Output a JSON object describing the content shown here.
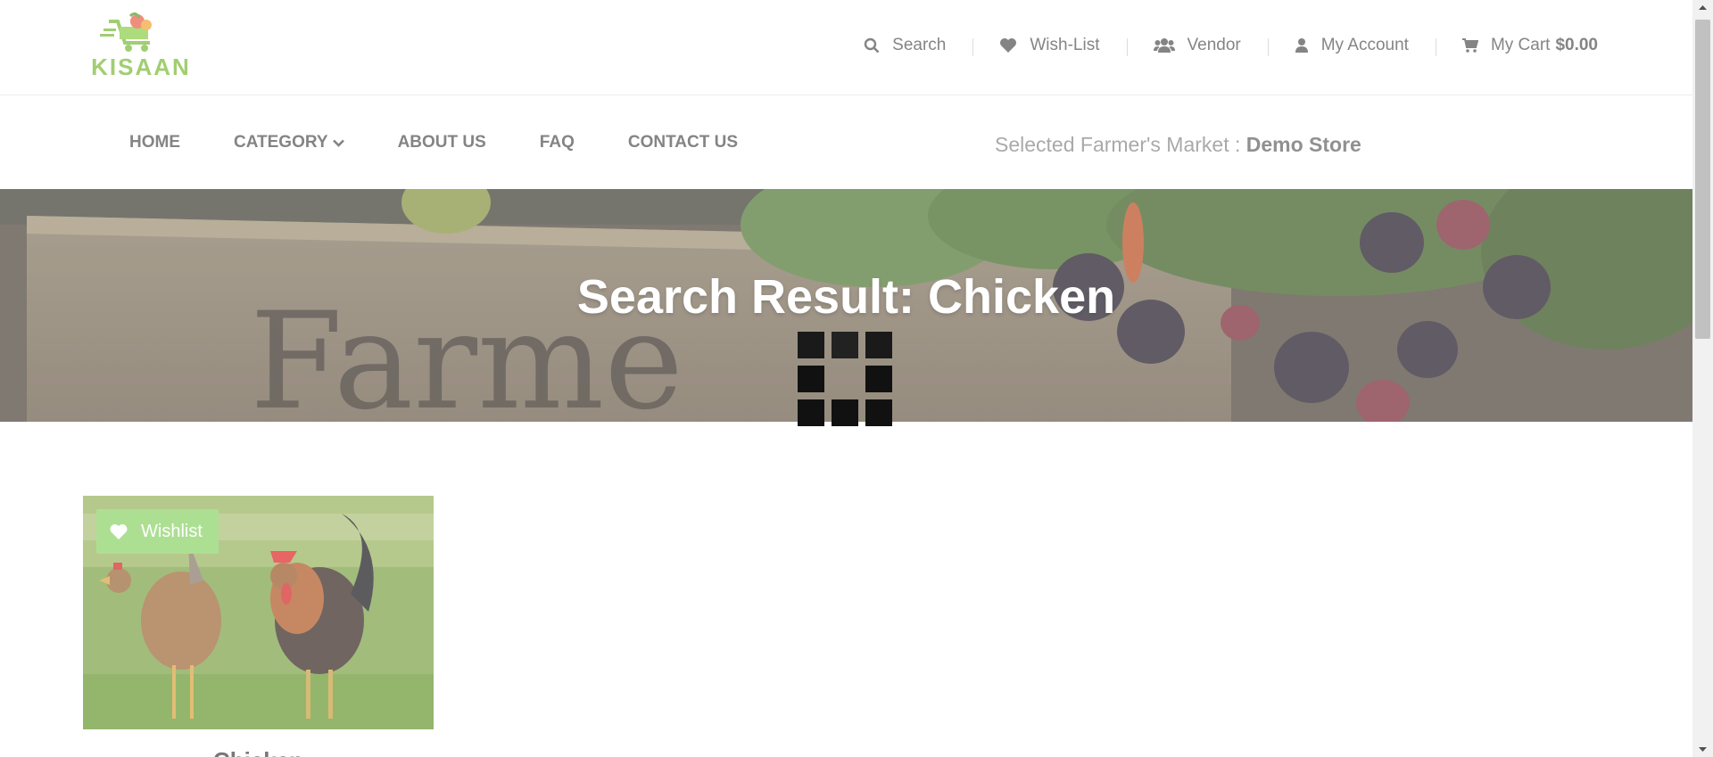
{
  "logo": {
    "text": "KISAAN"
  },
  "top_links": {
    "search": "Search",
    "wishlist": "Wish-List",
    "vendor": "Vendor",
    "account": "My Account",
    "cart_label": "My Cart",
    "cart_amount": "$0.00"
  },
  "nav": {
    "home": "HOME",
    "category": "CATEGORY",
    "about": "ABOUT US",
    "faq": "FAQ",
    "contact": "CONTACT US"
  },
  "market": {
    "label": "Selected Farmer's Market :",
    "store": "Demo Store"
  },
  "hero": {
    "title": "Search Result: Chicken",
    "watermark": "Farme"
  },
  "product": {
    "wishlist_label": "Wishlist",
    "name": "Chicken"
  },
  "colors": {
    "brand_green": "#7dbb3c",
    "wishlist_green": "#8ed36a"
  }
}
